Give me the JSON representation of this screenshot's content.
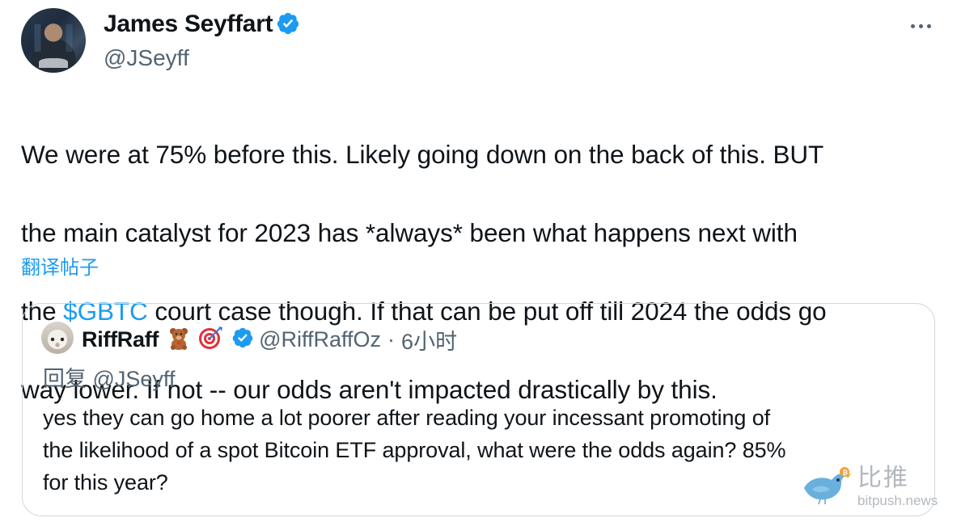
{
  "tweet": {
    "author": {
      "name": "James Seyffart",
      "handle": "@JSeyff",
      "avatar_icon": "profile-photo",
      "verified": true
    },
    "more_icon": "more-horizontal-icon",
    "text_lines": [
      {
        "text": "We were at 75% before this. Likely going down on the back of this. BUT"
      },
      {
        "text": "the main catalyst for 2023 has *always* been what happens next with"
      },
      {
        "pre": "the ",
        "cashtag": "$GBTC",
        "post": " court case though. If that can be put off till 2024 the odds go"
      },
      {
        "text": "way lower. If not -- our odds aren't impacted drastically by this."
      }
    ],
    "translate_label": "翻译帖子"
  },
  "quote": {
    "author": {
      "name": "RiffRaff",
      "emojis": [
        "teddy-bear-emoji",
        "direct-hit-emoji"
      ],
      "handle": "@RiffRaffOz",
      "separator": "·",
      "time": "6小时",
      "verified": true
    },
    "reply_to": "回复 @JSeyff",
    "text_lines": [
      "yes they can go home a lot poorer after reading your incessant promoting of",
      "the likelihood of a spot Bitcoin ETF approval, what were the odds again? 85%",
      "for this year?"
    ]
  },
  "watermark": {
    "cn": "比推",
    "en": "bitpush.news"
  },
  "colors": {
    "accent": "#1d9bf0",
    "secondary_text": "#536471",
    "border": "#cfd9de"
  }
}
